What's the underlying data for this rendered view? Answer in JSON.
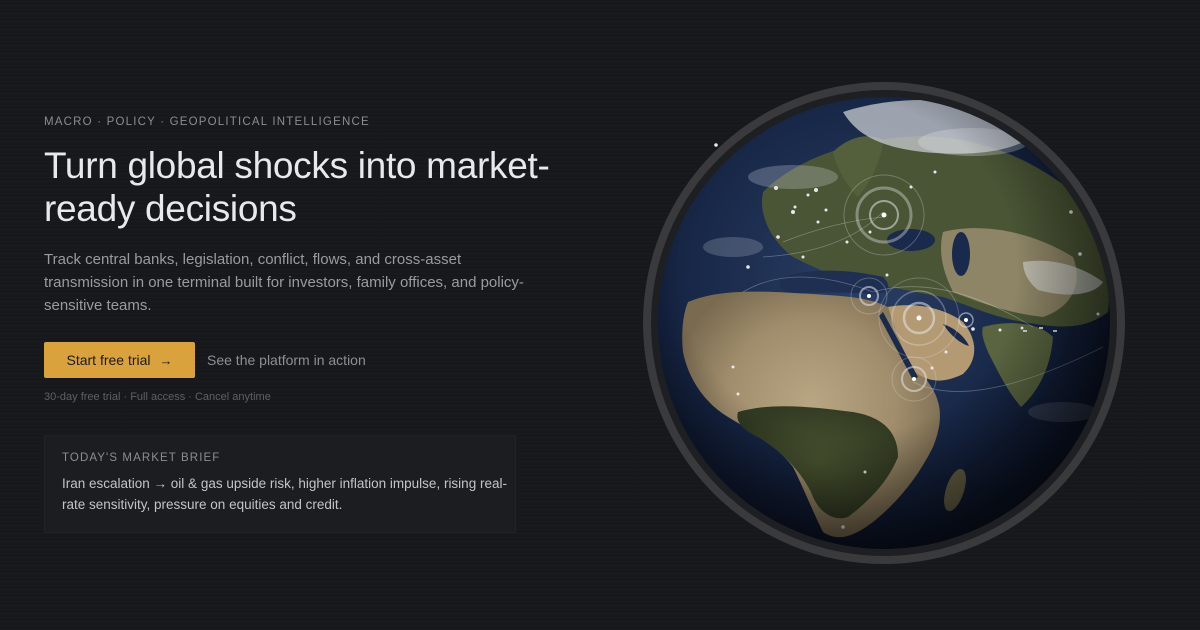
{
  "hero": {
    "eyebrow": "MACRO · POLICY · GEOPOLITICAL INTELLIGENCE",
    "headline_line1": "Turn global shocks into market-",
    "headline_line2": "ready decisions",
    "subcopy": "Track central banks, legislation, conflict, flows, and cross-asset transmission in one terminal built for investors, family offices, and policy-sensitive teams.",
    "primary_cta": "Start free trial",
    "primary_cta_icon": "arrow-right-icon",
    "secondary_cta": "See the platform in action",
    "fineprint": "30-day free trial · Full access · Cancel anytime"
  },
  "brief": {
    "title": "TODAY'S MARKET BRIEF",
    "text": "Iran escalation → oil & gas upside risk, higher inflation impulse, rising real-rate sensitivity, pressure on equities and credit."
  },
  "colors": {
    "background": "#17181c",
    "accent": "#d9a23d",
    "text_primary": "#e9e9eb",
    "text_muted": "#9a9aa0"
  }
}
